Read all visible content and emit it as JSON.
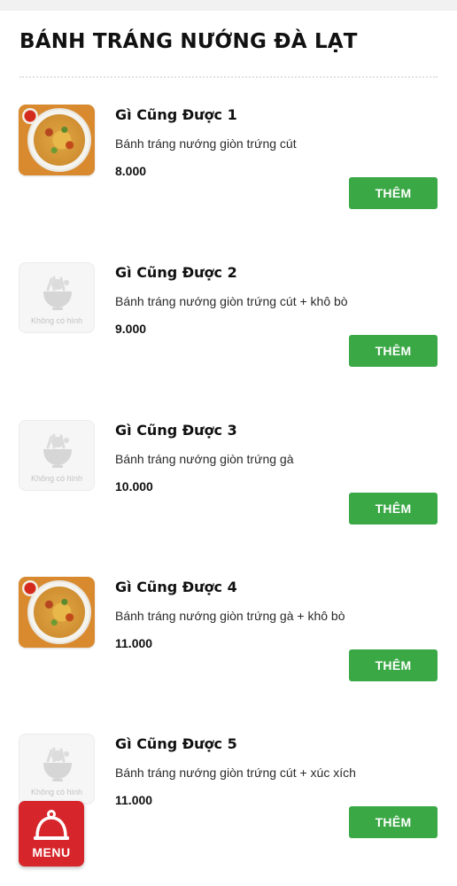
{
  "section": {
    "title": "BÁNH TRÁNG NƯỚNG ĐÀ LẠT"
  },
  "placeholder_text": "Không có hình",
  "items": [
    {
      "name": "Gì Cũng Được 1",
      "description": "Bánh tráng nướng giòn trứng cút",
      "price": "8.000",
      "image": "photo",
      "add_label": "THÊM"
    },
    {
      "name": "Gì Cũng Được 2",
      "description": "Bánh tráng nướng giòn trứng cút + khô bò",
      "price": "9.000",
      "image": "placeholder",
      "add_label": "THÊM"
    },
    {
      "name": "Gì Cũng Được 3",
      "description": "Bánh tráng nướng giòn trứng gà",
      "price": "10.000",
      "image": "placeholder",
      "add_label": "THÊM"
    },
    {
      "name": "Gì Cũng Được 4",
      "description": "Bánh tráng nướng giòn trứng gà + khô bò",
      "price": "11.000",
      "image": "photo",
      "add_label": "THÊM"
    },
    {
      "name": "Gì Cũng Được 5",
      "description": "Bánh tráng nướng giòn trứng cút + xúc xích",
      "price": "11.000",
      "image": "placeholder",
      "add_label": "THÊM"
    }
  ],
  "menu_button": {
    "label": "MENU",
    "icon": "cloche-icon"
  },
  "colors": {
    "accent_green": "#3aa845",
    "menu_red": "#d7262b"
  }
}
